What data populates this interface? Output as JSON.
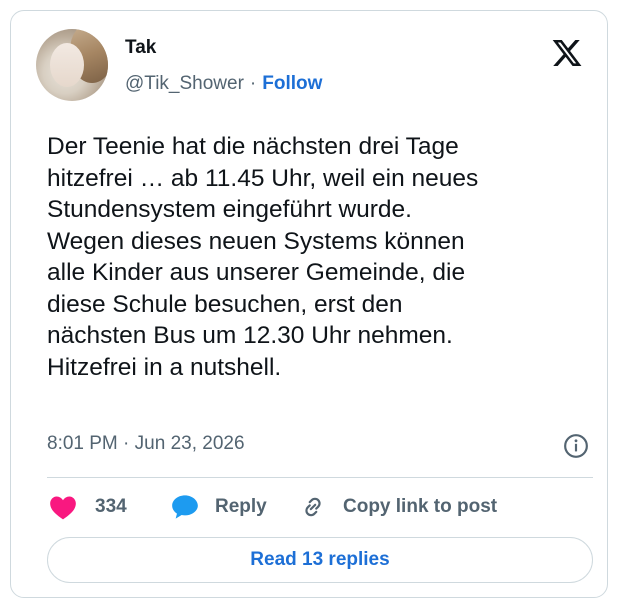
{
  "author": {
    "name": "Tak",
    "handle": "@Tik_Shower",
    "separator": "·",
    "follow_label": "Follow"
  },
  "brand_icon": "x-logo-icon",
  "tweet": {
    "lines": [
      "Der Teenie hat die nächsten drei Tage",
      "hitzefrei … ab 11.45 Uhr, weil ein neues",
      "Stundensystem eingeführt wurde.",
      "Wegen dieses neuen Systems können",
      "alle Kinder aus unserer Gemeinde, die",
      "diese Schule besuchen, erst den",
      "nächsten Bus um 12.30 Uhr nehmen.",
      "Hitzefrei in a nutshell."
    ]
  },
  "meta": {
    "time": "8:01 PM",
    "separator": "·",
    "date": "Jun 23, 2026",
    "info_icon": "info-icon"
  },
  "actions": {
    "like_icon": "heart-icon",
    "like_count": "334",
    "reply_icon": "speech-bubble-icon",
    "reply_label": "Reply",
    "copy_icon": "link-icon",
    "copy_label": "Copy link to post"
  },
  "read_replies_label": "Read 13 replies",
  "colors": {
    "accent": "#1d6fd6",
    "like": "#f91880",
    "text": "#0f1419",
    "muted": "#536471",
    "border": "#cfd9de"
  }
}
